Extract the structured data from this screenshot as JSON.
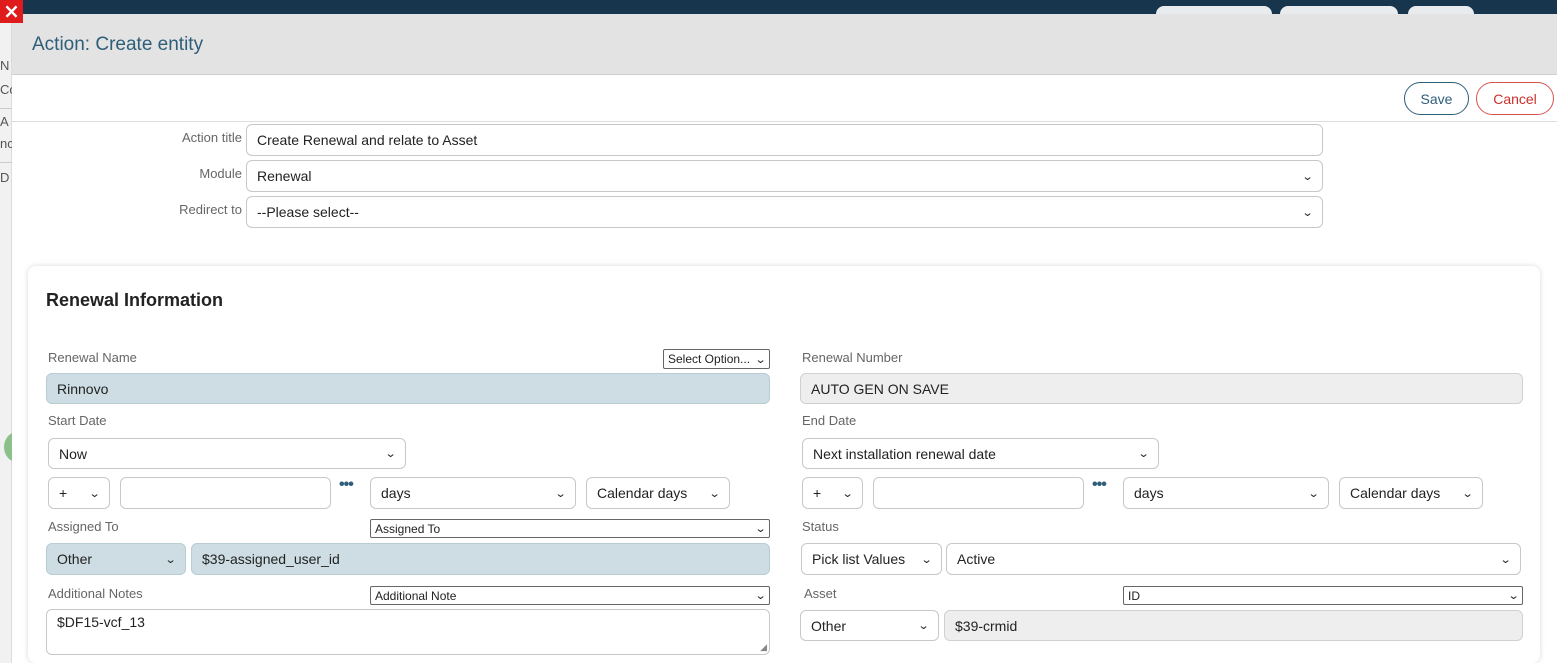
{
  "modal": {
    "title": "Action: Create entity",
    "save_label": "Save",
    "cancel_label": "Cancel"
  },
  "background": {
    "fragments": [
      "N",
      "Co",
      "A",
      "nc",
      "D"
    ]
  },
  "form": {
    "action_title_label": "Action title",
    "action_title_value": "Create Renewal and relate to Asset",
    "module_label": "Module",
    "module_value": "Renewal",
    "redirect_label": "Redirect to",
    "redirect_value": "--Please select--"
  },
  "section": {
    "title": "Renewal Information",
    "renewal_name": {
      "label": "Renewal Name",
      "option_select": "Select Option...",
      "value": "Rinnovo"
    },
    "renewal_number": {
      "label": "Renewal Number",
      "value": "AUTO GEN ON SAVE"
    },
    "start_date": {
      "label": "Start Date",
      "value": "Now",
      "sign": "+",
      "amount": "",
      "unit": "days",
      "day_type": "Calendar days"
    },
    "end_date": {
      "label": "End Date",
      "value": "Next installation renewal date",
      "sign": "+",
      "amount": "",
      "unit": "days",
      "day_type": "Calendar days"
    },
    "assigned_to": {
      "label": "Assigned To",
      "field_select": "Assigned To",
      "type": "Other",
      "value": "$39-assigned_user_id"
    },
    "status": {
      "label": "Status",
      "type": "Pick list Values",
      "value": "Active"
    },
    "additional_notes": {
      "label": "Additional Notes",
      "field_select": "Additional Note",
      "value": "$DF15-vcf_13"
    },
    "asset": {
      "label": "Asset",
      "field_select": "ID",
      "type": "Other",
      "value": "$39-crmid"
    },
    "more_icon": "•••"
  },
  "icons": {
    "close": "close-icon",
    "chevron": "chevron-down-icon",
    "more": "more-dots-icon"
  },
  "colors": {
    "header_bg": "#e3e3e3",
    "title": "#2e5e79",
    "filled_input": "#cddde3",
    "readonly_input": "#eeeeee",
    "cancel": "#d9534f",
    "close": "#e01b1b"
  }
}
